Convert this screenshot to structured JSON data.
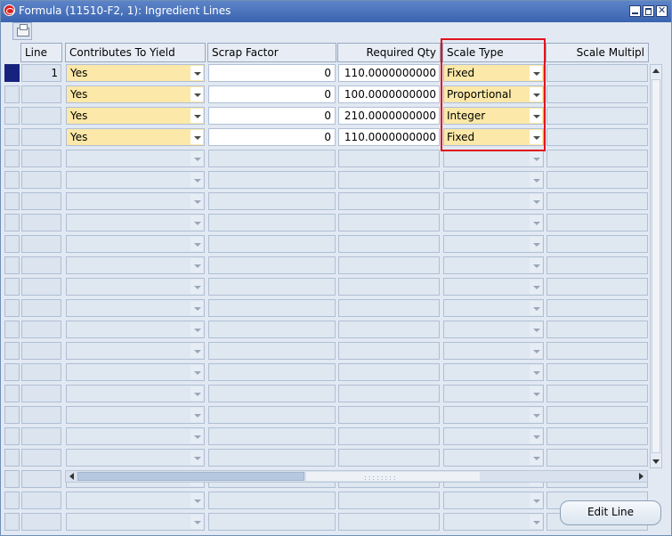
{
  "window": {
    "title": "Formula (11510-F2, 1): Ingredient Lines"
  },
  "toolbar": {
    "print_icon": "printer-icon"
  },
  "columns": {
    "line": "Line",
    "contributes_to_yield": "Contributes To Yield",
    "scrap_factor": "Scrap Factor",
    "required_qty": "Required Qty",
    "scale_type": "Scale Type",
    "scale_multiple": "Scale Multipl"
  },
  "rows": [
    {
      "line": "1",
      "contributes_to_yield": "Yes",
      "scrap_factor": "0",
      "required_qty": "110.0000000000",
      "scale_type": "Fixed",
      "scale_multiple": ""
    },
    {
      "line": "",
      "contributes_to_yield": "Yes",
      "scrap_factor": "0",
      "required_qty": "100.0000000000",
      "scale_type": "Proportional",
      "scale_multiple": ""
    },
    {
      "line": "",
      "contributes_to_yield": "Yes",
      "scrap_factor": "0",
      "required_qty": "210.0000000000",
      "scale_type": "Integer",
      "scale_multiple": ""
    },
    {
      "line": "",
      "contributes_to_yield": "Yes",
      "scrap_factor": "0",
      "required_qty": "110.0000000000",
      "scale_type": "Fixed",
      "scale_multiple": ""
    }
  ],
  "empty_rows": 18,
  "buttons": {
    "edit_line": "Edit Line"
  },
  "colors": {
    "titlebar": "#3a64b0",
    "required_field": "#fce8a8",
    "highlight": "#e0141d",
    "current_row": "#16237e"
  }
}
